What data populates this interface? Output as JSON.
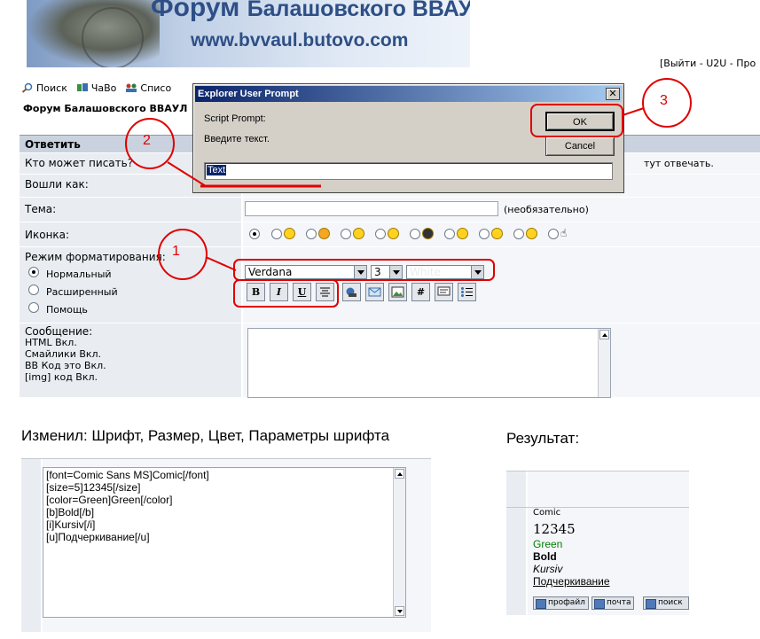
{
  "banner": {
    "title_word": "Форум",
    "title_rest": "Балашовского ВВАУЛ",
    "url": "www.bvvaul.butovo.com"
  },
  "top_right": {
    "links": "[Выйти - U2U - Про"
  },
  "nav": {
    "items": [
      {
        "label": "Поиск",
        "icon": "search-icon"
      },
      {
        "label": "ЧаВо",
        "icon": "faq-icon"
      },
      {
        "label": "Списо",
        "icon": "members-icon"
      }
    ]
  },
  "breadcrumb": "Форум Балашовского ВВАУЛ",
  "form": {
    "header": "Ответить",
    "who_can_write_label": "Кто может писать?",
    "who_can_write_value": "тут отвечать.",
    "logged_as_label": "Вошли как:",
    "subject_label": "Тема:",
    "subject_hint": "(необязательно)",
    "icon_label": "Иконка:",
    "format_mode_label": "Режим форматирования:",
    "format_modes": [
      "Нормальный",
      "Расширенный",
      "Помощь"
    ],
    "font_select": "Verdana",
    "size_select": "3",
    "color_select": "White",
    "toolbar": {
      "bold": "B",
      "italic": "I",
      "underline": "U",
      "hash": "#"
    },
    "message_label": "Сообщение:",
    "message_info": [
      "HTML Вкл.",
      "Смайлики Вкл.",
      "BB Код это Вкл.",
      "[img] код Вкл."
    ]
  },
  "dialog": {
    "title": "Explorer User Prompt",
    "close": "✕",
    "script_prompt": "Script Prompt:",
    "instruction": "Введите текст.",
    "ok": "OK",
    "cancel": "Cancel",
    "input_value": "Text"
  },
  "annotations": {
    "n1": "1",
    "n2": "2",
    "n3": "3",
    "color": "#e00000"
  },
  "changed_title": "Изменил: Шрифт, Размер, Цвет, Параметры шрифта",
  "code_lines": [
    "[font=Comic Sans MS]Comic[/font]",
    "[size=5]12345[/size]",
    "[color=Green]Green[/color]",
    "[b]Bold[/b]",
    "[i]Kursiv[/i]",
    "[u]Подчеркивание[/u]"
  ],
  "result_title": "Результат:",
  "result": {
    "comic": "Comic",
    "size": "12345",
    "green": "Green",
    "bold": "Bold",
    "italic": "Kursiv",
    "underline": "Подчеркивание",
    "buttons": [
      "профайл",
      "почта",
      "поиск"
    ]
  },
  "colors": {
    "header_bg": "#c9d2de",
    "row_bg": "#e9edf2",
    "green": "#008000",
    "title_blue": "#2e4f86"
  }
}
